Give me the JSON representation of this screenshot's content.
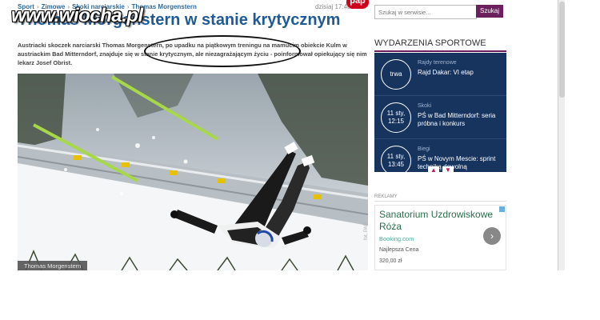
{
  "breadcrumb": [
    "Sport",
    "Zimowe",
    "Skoki narciarskie",
    "Thomas Morgenstern"
  ],
  "date": "dzisiaj 17:48",
  "pap_logo": "pap",
  "watermark": "www.wiocha.pl",
  "headline": "Thomas Morgenstern w stanie krytycznym",
  "lead": "Austriacki skoczek narciarski Thomas Morgenstern, po upadku na piątkowym treningu na mamucim obiekcie Kulm w austriackim Bad Mitterndorf, znajduje się w stanie krytycznym, ale niezagrażającym życiu - poinformował opiekujący się nim lekarz Josef Obrist.",
  "photo_caption": "Thomas Morgenstern",
  "search": {
    "placeholder": "Szukaj w serwisie...",
    "button": "Szukaj"
  },
  "events": {
    "title": "WYDARZENIA SPORTOWE",
    "items": [
      {
        "when": "trwa",
        "category": "Rajdy terenowe",
        "name": "Rajd Dakar: VI etap"
      },
      {
        "when": "11 sty, 12:15",
        "category": "Skoki",
        "name": "PŚ w Bad Mitterndorf: seria próbna i konkurs"
      },
      {
        "when": "11 sty, 13:45",
        "category": "Biegi",
        "name": "PŚ w Novym Mescie: sprint techniką dowolną"
      }
    ]
  },
  "ads": {
    "label": "REKLAMY",
    "title": "Sanatorium Uzdrowiskowe Róża",
    "url": "Booking.com",
    "price_label": "Najlepsza Cena",
    "price": "320,00 zł"
  },
  "colors": {
    "accent": "#6b1f5c",
    "headline": "#1f5a96",
    "events_bg": "#17345f"
  }
}
